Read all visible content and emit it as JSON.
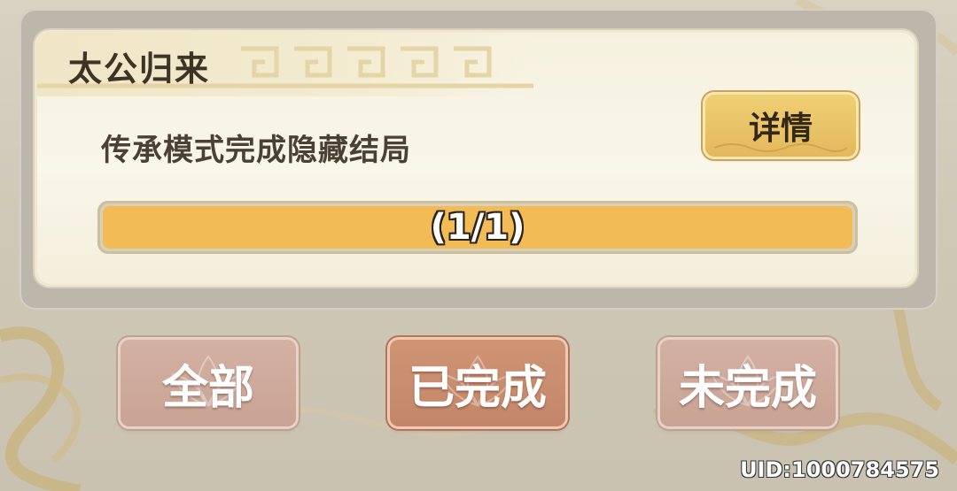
{
  "achievement": {
    "title": "太公归来",
    "description": "传承模式完成隐藏结局",
    "detail_label": "详情",
    "progress_text": "(1/1)",
    "progress_fraction": 1.0
  },
  "filters": {
    "all_label": "全部",
    "completed_label": "已完成",
    "incomplete_label": "未完成",
    "active": "completed"
  },
  "footer": {
    "uid": "UID:1000784575"
  },
  "colors": {
    "progress_fill": "#f2bb55",
    "detail_button": "#e4b85c",
    "filter_active": "#c3866a",
    "filter_inactive": "#c9a394"
  }
}
